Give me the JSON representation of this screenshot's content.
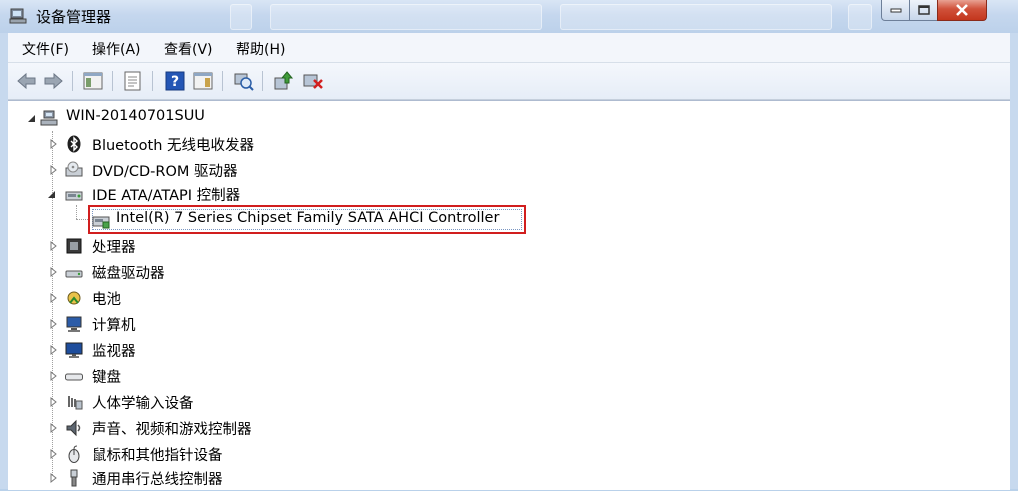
{
  "window": {
    "title": "设备管理器"
  },
  "menu": [
    {
      "label": "文件(F)"
    },
    {
      "label": "操作(A)"
    },
    {
      "label": "查看(V)"
    },
    {
      "label": "帮助(H)"
    }
  ],
  "tree": {
    "root": "WIN-20140701SUU",
    "categories": [
      {
        "label": "Bluetooth 无线电收发器",
        "icon": "bluetooth-icon"
      },
      {
        "label": "DVD/CD-ROM 驱动器",
        "icon": "dvd-drive-icon"
      },
      {
        "label": "IDE ATA/ATAPI 控制器",
        "icon": "ide-controller-icon",
        "expanded": true,
        "children": [
          {
            "label": "Intel(R) 7 Series Chipset Family SATA AHCI Controller",
            "icon": "controller-device-icon"
          }
        ]
      },
      {
        "label": "处理器",
        "icon": "processor-icon"
      },
      {
        "label": "磁盘驱动器",
        "icon": "disk-drive-icon"
      },
      {
        "label": "电池",
        "icon": "battery-icon"
      },
      {
        "label": "计算机",
        "icon": "computer-icon"
      },
      {
        "label": "监视器",
        "icon": "monitor-icon"
      },
      {
        "label": "键盘",
        "icon": "keyboard-icon"
      },
      {
        "label": "人体学输入设备",
        "icon": "hid-icon"
      },
      {
        "label": "声音、视频和游戏控制器",
        "icon": "sound-icon"
      },
      {
        "label": "鼠标和其他指针设备",
        "icon": "mouse-icon"
      },
      {
        "label": "通用串行总线控制器",
        "icon": "usb-icon"
      }
    ]
  },
  "colors": {
    "highlight_border": "#d11e1e",
    "frame": "#b9d1ea"
  }
}
